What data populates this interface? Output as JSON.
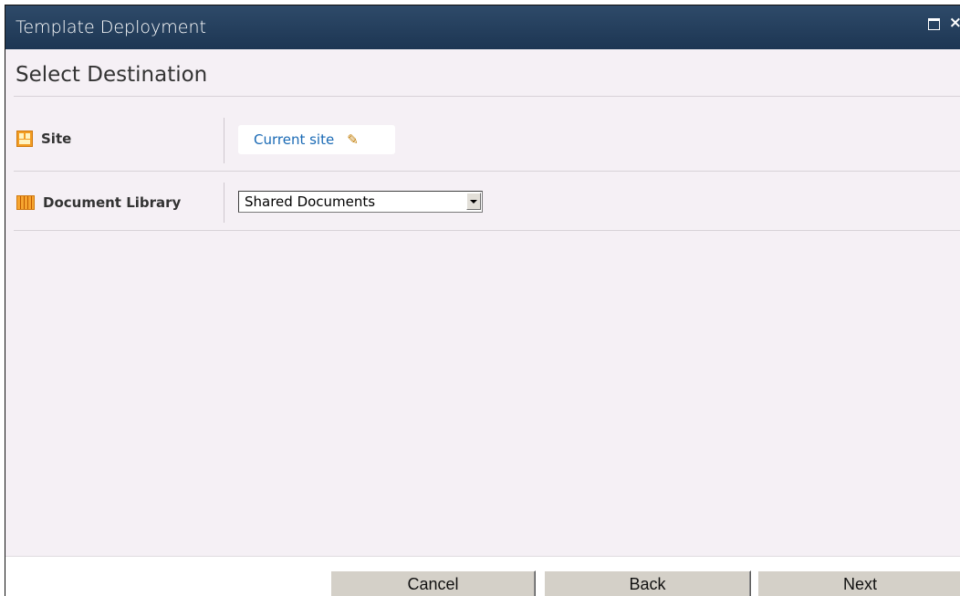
{
  "window": {
    "title": "Template Deployment",
    "maximize_icon": "maximize-icon",
    "close_icon": "close-icon",
    "close_glyph": "×"
  },
  "page": {
    "heading": "Select Destination"
  },
  "fields": {
    "site": {
      "icon": "site-icon",
      "label": "Site",
      "value": "Current site",
      "edit_icon": "pencil-icon"
    },
    "library": {
      "icon": "document-library-icon",
      "label": "Document Library",
      "selected": "Shared Documents",
      "dropdown_icon": "chevron-down-icon"
    }
  },
  "footer": {
    "cancel_label": "Cancel",
    "back_label": "Back",
    "next_label": "Next"
  },
  "colors": {
    "titlebar": "#1d3653",
    "content_bg": "#f5f0f5",
    "link": "#1a6ab5",
    "button_face": "#d4d0c8"
  }
}
